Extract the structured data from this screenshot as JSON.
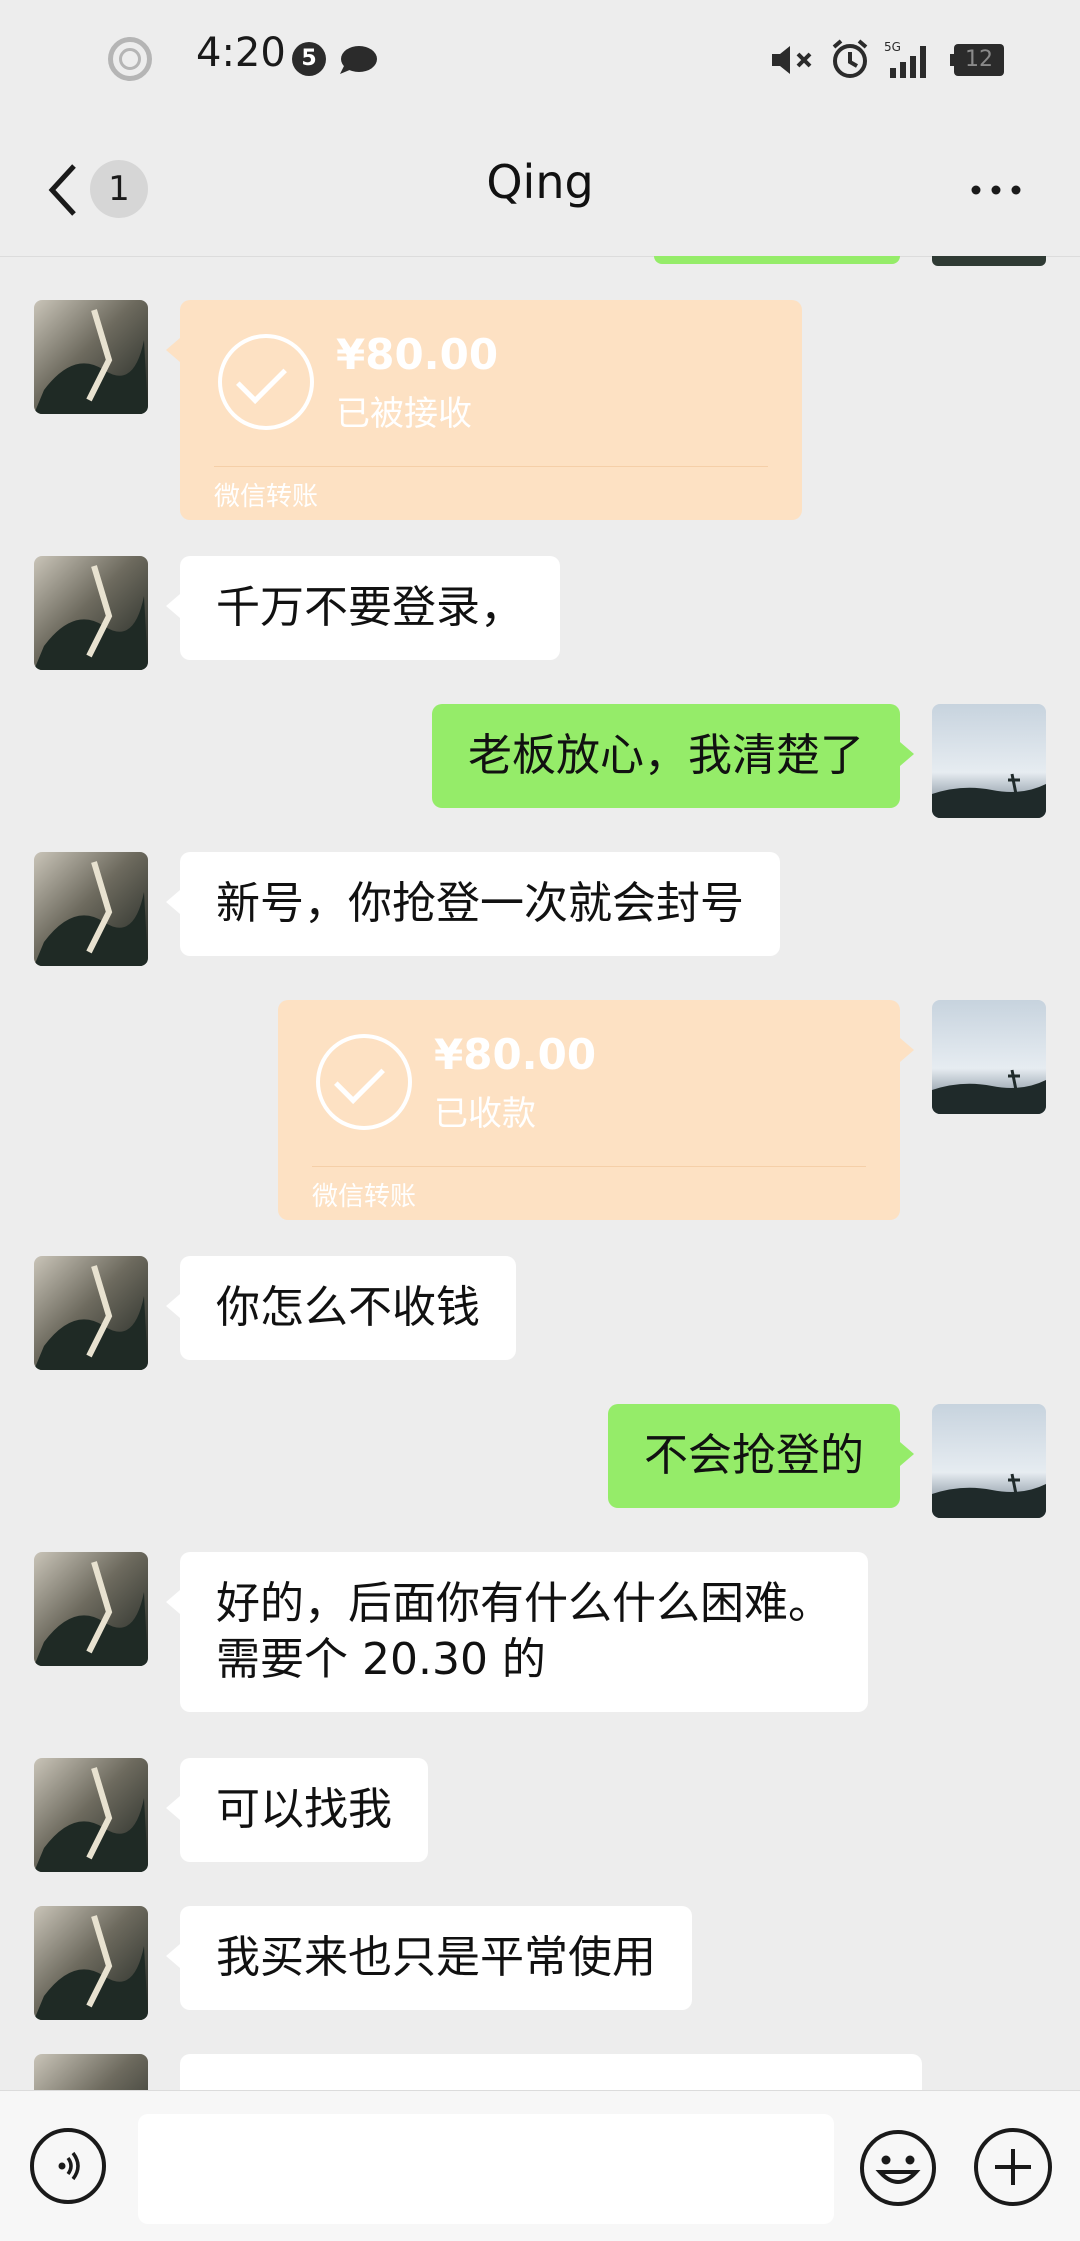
{
  "status_bar": {
    "time": "4:20",
    "notification_count": "5",
    "network": "5G",
    "battery": "12"
  },
  "header": {
    "unread_count": "1",
    "title": "Qing"
  },
  "messages": [
    {
      "side": "left",
      "type": "transfer",
      "amount": "¥80.00",
      "state": "已被接收",
      "caption": "微信转账"
    },
    {
      "side": "left",
      "type": "text",
      "text": "千万不要登录，"
    },
    {
      "side": "right",
      "type": "text",
      "text": "老板放心，我清楚了"
    },
    {
      "side": "left",
      "type": "text",
      "text": "新号，你抢登一次就会封号"
    },
    {
      "side": "right",
      "type": "transfer",
      "amount": "¥80.00",
      "state": "已收款",
      "caption": "微信转账"
    },
    {
      "side": "left",
      "type": "text",
      "text": "你怎么不收钱"
    },
    {
      "side": "right",
      "type": "text",
      "text": "不会抢登的"
    },
    {
      "side": "left",
      "type": "text",
      "text_line1": "好的，后面你有什么什么困难。",
      "text_line2": "需要个 20.30 的"
    },
    {
      "side": "left",
      "type": "text",
      "text": "可以找我"
    },
    {
      "side": "left",
      "type": "text",
      "text": "我买来也只是平常使用"
    }
  ],
  "colors": {
    "background": "#ededed",
    "own_bubble": "#95ec69",
    "other_bubble": "#ffffff",
    "transfer_bubble": "#fde1c3"
  }
}
